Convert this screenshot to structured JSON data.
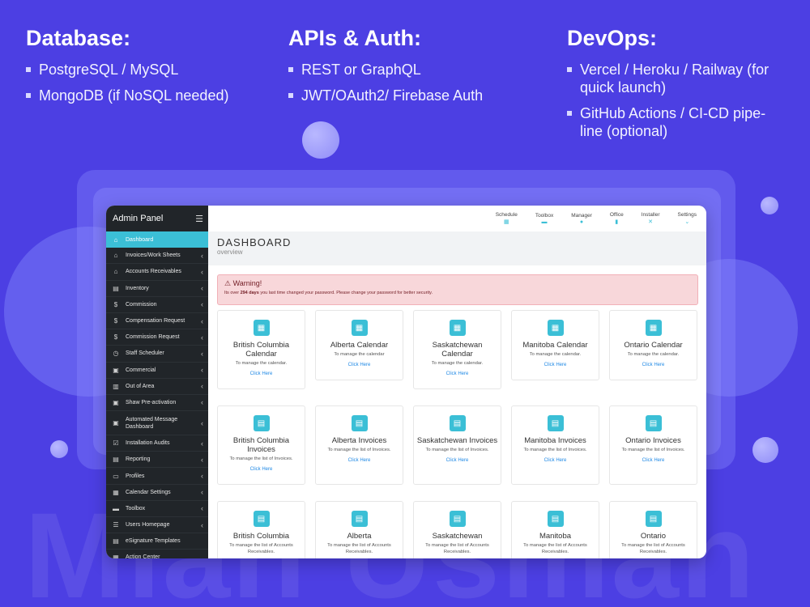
{
  "tech": {
    "database": {
      "title": "Database:",
      "items": [
        "PostgreSQL / MySQL",
        "MongoDB (if NoSQL needed)"
      ]
    },
    "apis": {
      "title": "APIs & Auth:",
      "items": [
        "REST or GraphQL",
        "JWT/OAuth2/ Firebase Auth"
      ]
    },
    "devops": {
      "title": "DevOps:",
      "items": [
        "Vercel / Heroku / Railway (for quick launch)",
        "GitHub Actions / CI-CD pipe-line (optional)"
      ]
    }
  },
  "watermark": "Mian Usman",
  "sidebar": {
    "title": "Admin Panel",
    "items": [
      {
        "label": "Dashboard",
        "icon": "home-icon",
        "glyph": "⌂"
      },
      {
        "label": "Invoices/Work Sheets",
        "icon": "home-icon",
        "glyph": "⌂"
      },
      {
        "label": "Accounts Receivables",
        "icon": "home-icon",
        "glyph": "⌂"
      },
      {
        "label": "Inventory",
        "icon": "clipboard-icon",
        "glyph": "▤"
      },
      {
        "label": "Commission",
        "icon": "dollar-icon",
        "glyph": "$"
      },
      {
        "label": "Compensation Request",
        "icon": "dollar-icon",
        "glyph": "$"
      },
      {
        "label": "Commission Request",
        "icon": "dollar-icon",
        "glyph": "$"
      },
      {
        "label": "Staff Scheduler",
        "icon": "clock-icon",
        "glyph": "◷"
      },
      {
        "label": "Commercial",
        "icon": "server-icon",
        "glyph": "▣"
      },
      {
        "label": "Out of Area",
        "icon": "map-icon",
        "glyph": "▥"
      },
      {
        "label": "Shaw Pre-activation",
        "icon": "server-icon",
        "glyph": "▣"
      },
      {
        "label": "Automated Message Dashboard",
        "icon": "server-icon",
        "glyph": "▣"
      },
      {
        "label": "Installation Audits",
        "icon": "checkbox-icon",
        "glyph": "☑"
      },
      {
        "label": "Reporting",
        "icon": "report-icon",
        "glyph": "▤"
      },
      {
        "label": "Profiles",
        "icon": "id-card-icon",
        "glyph": "▭"
      },
      {
        "label": "Calendar Settings",
        "icon": "calendar-icon",
        "glyph": "▦"
      },
      {
        "label": "Toolbox",
        "icon": "toolbox-icon",
        "glyph": "▬"
      },
      {
        "label": "Users Homepage",
        "icon": "list-icon",
        "glyph": "☰"
      },
      {
        "label": "eSignature Templates",
        "icon": "document-icon",
        "glyph": "▤"
      },
      {
        "label": "Action Center",
        "icon": "calendar-icon",
        "glyph": "▦"
      }
    ]
  },
  "topnav": {
    "items": [
      {
        "label": "Schedule",
        "icon": "calendar-icon",
        "glyph": "▦"
      },
      {
        "label": "Toolbox",
        "icon": "toolbox-icon",
        "glyph": "▬"
      },
      {
        "label": "Manager",
        "icon": "user-icon",
        "glyph": "●"
      },
      {
        "label": "Office",
        "icon": "building-icon",
        "glyph": "▮"
      },
      {
        "label": "Installer",
        "icon": "tools-icon",
        "glyph": "✕"
      },
      {
        "label": "Settings",
        "icon": "chevron-down-icon",
        "glyph": "⌄"
      }
    ]
  },
  "dashboard": {
    "title": "DASHBOARD",
    "subtitle": "overview",
    "warning_title": "Warning!",
    "warning_pre": "Its over ",
    "warning_bold": "294 days",
    "warning_post": " you last time changed your password. Please change your password for better security.",
    "link_label": "Click Here"
  },
  "cards": [
    {
      "title": "British Columbia Calendar",
      "desc": "To manage the calendar.",
      "icon": "calendar-icon",
      "glyph": "▦"
    },
    {
      "title": "Alberta Calendar",
      "desc": "To manage the calendar",
      "icon": "calendar-icon",
      "glyph": "▦"
    },
    {
      "title": "Saskatchewan Calendar",
      "desc": "To manage the calendar.",
      "icon": "calendar-icon",
      "glyph": "▦"
    },
    {
      "title": "Manitoba Calendar",
      "desc": "To manage the calendar.",
      "icon": "calendar-icon",
      "glyph": "▦"
    },
    {
      "title": "Ontario Calendar",
      "desc": "To manage the calendar.",
      "icon": "calendar-icon",
      "glyph": "▦"
    },
    {
      "title": "British Columbia Invoices",
      "desc": "To manage the list of Invoices.",
      "icon": "invoice-icon",
      "glyph": "▤"
    },
    {
      "title": "Alberta Invoices",
      "desc": "To manage the list of Invoices.",
      "icon": "invoice-icon",
      "glyph": "▤"
    },
    {
      "title": "Saskatchewan Invoices",
      "desc": "To manage the list of Invoices.",
      "icon": "invoice-icon",
      "glyph": "▤"
    },
    {
      "title": "Manitoba Invoices",
      "desc": "To manage the list of Invoices.",
      "icon": "invoice-icon",
      "glyph": "▤"
    },
    {
      "title": "Ontario Invoices",
      "desc": "To manage the list of Invoices.",
      "icon": "invoice-icon",
      "glyph": "▤"
    },
    {
      "title": "British Columbia",
      "desc": "To manage the list of Accounts Receivables.",
      "icon": "receivables-icon",
      "glyph": "▤"
    },
    {
      "title": "Alberta",
      "desc": "To manage the list of Accounts Receivables.",
      "icon": "receivables-icon",
      "glyph": "▤"
    },
    {
      "title": "Saskatchewan",
      "desc": "To manage the list of Accounts Receivables.",
      "icon": "receivables-icon",
      "glyph": "▤"
    },
    {
      "title": "Manitoba",
      "desc": "To manage the list of Accounts Receivables.",
      "icon": "receivables-icon",
      "glyph": "▤"
    },
    {
      "title": "Ontario",
      "desc": "To manage the list of Accounts Receivables.",
      "icon": "receivables-icon",
      "glyph": "▤"
    }
  ],
  "colors": {
    "background": "#4c3fe3",
    "accent": "#3bbfd6",
    "sidebar": "#212529",
    "link": "#1e88e5",
    "warning_bg": "#f8d7da"
  }
}
